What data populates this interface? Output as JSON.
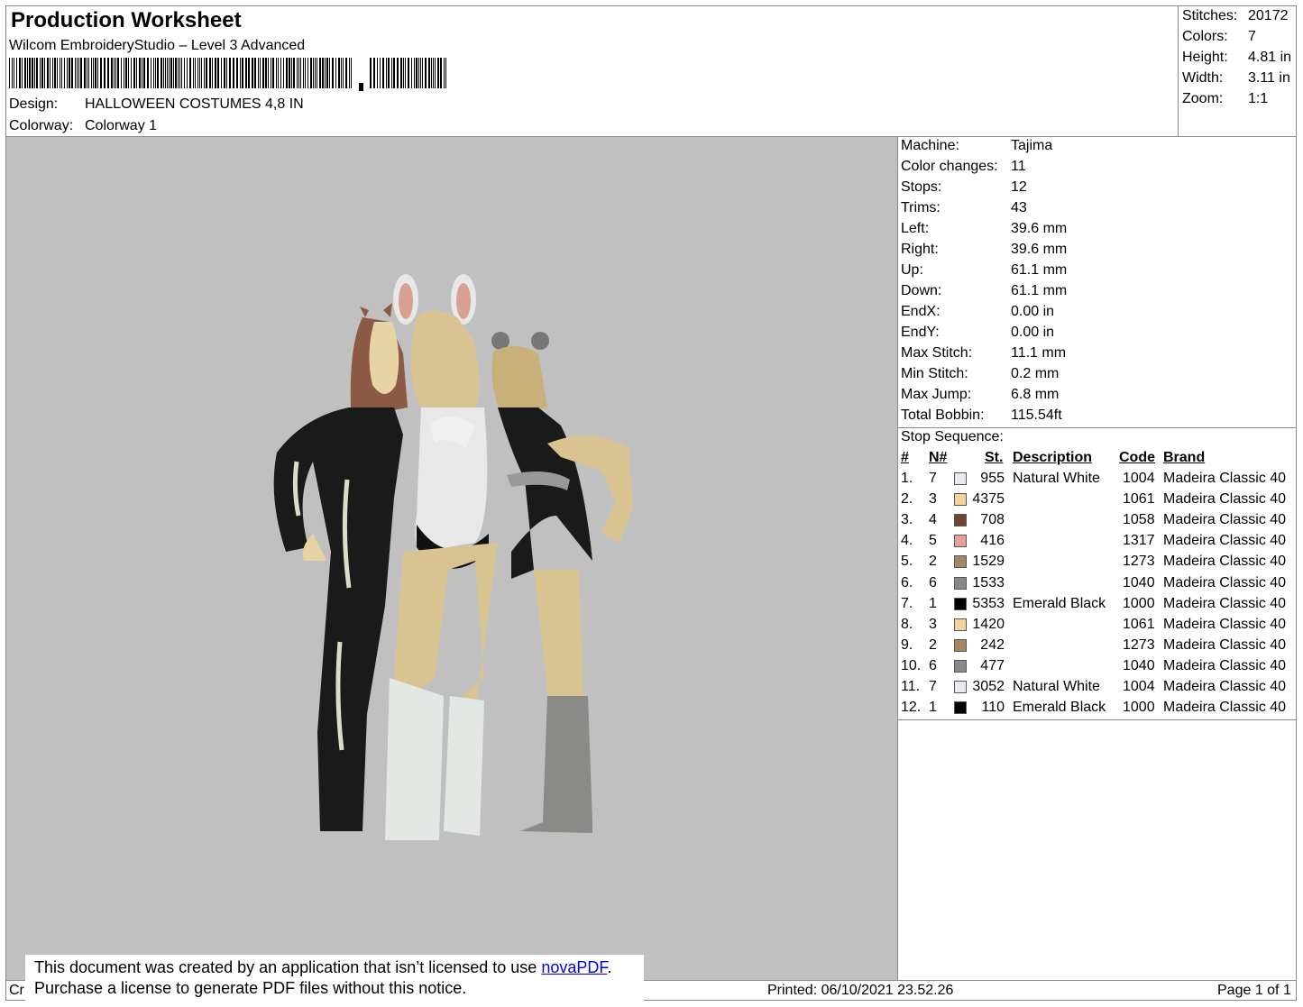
{
  "header": {
    "title": "Production Worksheet",
    "software": "Wilcom EmbroideryStudio – Level 3 Advanced",
    "design_label": "Design:",
    "design_value": "HALLOWEEN COSTUMES 4,8 IN",
    "colorway_label": "Colorway:",
    "colorway_value": "Colorway 1"
  },
  "stats": [
    {
      "label": "Stitches:",
      "value": "20172"
    },
    {
      "label": "Colors:",
      "value": "7"
    },
    {
      "label": "Height:",
      "value": "4.81 in"
    },
    {
      "label": "Width:",
      "value": "3.11 in"
    },
    {
      "label": "Zoom:",
      "value": "1:1"
    }
  ],
  "specs": [
    {
      "label": "Machine:",
      "value": "Tajima"
    },
    {
      "label": "Color changes:",
      "value": "11"
    },
    {
      "label": "Stops:",
      "value": "12"
    },
    {
      "label": "Trims:",
      "value": "43"
    },
    {
      "label": "Left:",
      "value": "39.6 mm"
    },
    {
      "label": "Right:",
      "value": "39.6 mm"
    },
    {
      "label": "Up:",
      "value": "61.1 mm"
    },
    {
      "label": "Down:",
      "value": "61.1 mm"
    },
    {
      "label": "EndX:",
      "value": "0.00 in"
    },
    {
      "label": "EndY:",
      "value": "0.00 in"
    },
    {
      "label": "Max Stitch:",
      "value": "11.1 mm"
    },
    {
      "label": "Min Stitch:",
      "value": "0.2 mm"
    },
    {
      "label": "Max Jump:",
      "value": "6.8 mm"
    },
    {
      "label": "Total Bobbin:",
      "value": "115.54ft"
    }
  ],
  "stop_sequence": {
    "title": "Stop Sequence:",
    "columns": {
      "num": "#",
      "n": "N#",
      "st": "St.",
      "description": "Description",
      "code": "Code",
      "brand": "Brand"
    },
    "rows": [
      {
        "num": "1.",
        "n": "7",
        "st": "955",
        "description": "Natural White",
        "code": "1004",
        "brand": "Madeira Classic 40",
        "color": "#e8e8ee"
      },
      {
        "num": "2.",
        "n": "3",
        "st": "4375",
        "description": "",
        "code": "1061",
        "brand": "Madeira Classic 40",
        "color": "#f3d49a"
      },
      {
        "num": "3.",
        "n": "4",
        "st": "708",
        "description": "",
        "code": "1058",
        "brand": "Madeira Classic 40",
        "color": "#6e4434"
      },
      {
        "num": "4.",
        "n": "5",
        "st": "416",
        "description": "",
        "code": "1317",
        "brand": "Madeira Classic 40",
        "color": "#e8a09a"
      },
      {
        "num": "5.",
        "n": "2",
        "st": "1529",
        "description": "",
        "code": "1273",
        "brand": "Madeira Classic 40",
        "color": "#a48660"
      },
      {
        "num": "6.",
        "n": "6",
        "st": "1533",
        "description": "",
        "code": "1040",
        "brand": "Madeira Classic 40",
        "color": "#888888"
      },
      {
        "num": "7.",
        "n": "1",
        "st": "5353",
        "description": "Emerald Black",
        "code": "1000",
        "brand": "Madeira Classic 40",
        "color": "#000000"
      },
      {
        "num": "8.",
        "n": "3",
        "st": "1420",
        "description": "",
        "code": "1061",
        "brand": "Madeira Classic 40",
        "color": "#f3d49a"
      },
      {
        "num": "9.",
        "n": "2",
        "st": "242",
        "description": "",
        "code": "1273",
        "brand": "Madeira Classic 40",
        "color": "#a48660"
      },
      {
        "num": "10.",
        "n": "6",
        "st": "477",
        "description": "",
        "code": "1040",
        "brand": "Madeira Classic 40",
        "color": "#888888"
      },
      {
        "num": "11.",
        "n": "7",
        "st": "3052",
        "description": "Natural White",
        "code": "1004",
        "brand": "Madeira Classic 40",
        "color": "#e8e8ee"
      },
      {
        "num": "12.",
        "n": "1",
        "st": "110",
        "description": "Emerald Black",
        "code": "1000",
        "brand": "Madeira Classic 40",
        "color": "#000000"
      }
    ]
  },
  "notice": {
    "line1_pre": "This document was created by an application that isn’t licensed to use ",
    "link": "novaPDF",
    "line1_post": ".",
    "line2": "Purchase a license to generate PDF files without this notice."
  },
  "footer": {
    "left_fragment": "Cr",
    "printed": "Printed: 06/10/2021 23.52.26",
    "page": "Page 1 of 1"
  }
}
